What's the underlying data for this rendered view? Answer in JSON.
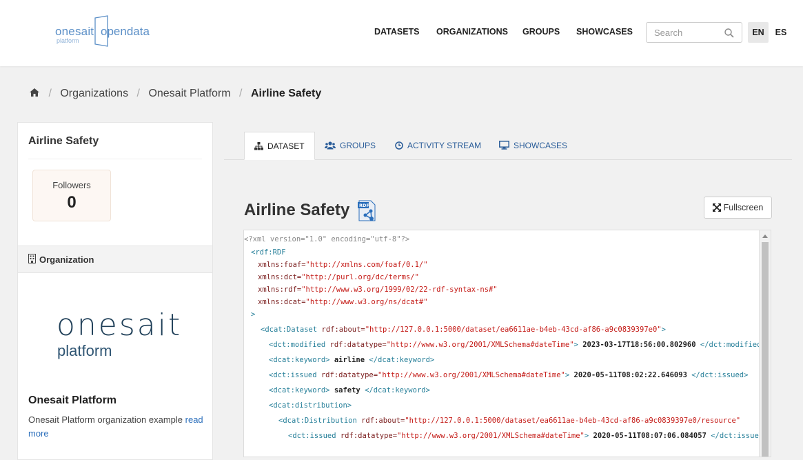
{
  "header": {
    "logo": {
      "left": "onesait",
      "sub": "platform",
      "right": "opendata"
    },
    "nav": [
      "DATASETS",
      "ORGANIZATIONS",
      "GROUPS",
      "SHOWCASES"
    ],
    "search_placeholder": "Search",
    "languages": [
      "EN",
      "ES"
    ],
    "active_language": "EN"
  },
  "breadcrumb": [
    "Organizations",
    "Onesait Platform",
    "Airline Safety"
  ],
  "sidebar": {
    "title": "Airline Safety",
    "followers_label": "Followers",
    "followers_count": "0",
    "org_section_label": "Organization",
    "org_logo_line1": "onesait",
    "org_logo_line2": "platform",
    "org_name": "Onesait Platform",
    "org_description": "Onesait Platform organization example",
    "read_more": "read more"
  },
  "tabs": [
    "DATASET",
    "GROUPS",
    "ACTIVITY STREAM",
    "SHOWCASES"
  ],
  "main": {
    "dataset_title": "Airline Safety",
    "fullscreen_label": "Fullscreen"
  },
  "code": [
    [
      [
        "p",
        "<?xml version=\"1.0\" encoding=\"utf-8\"?>"
      ]
    ],
    [
      [
        "t",
        "<rdf:RDF"
      ]
    ],
    [
      [
        "a",
        "xmlns:foaf="
      ],
      [
        "s",
        "\"http://xmlns.com/foaf/0.1/\""
      ]
    ],
    [
      [
        "a",
        "xmlns:dct="
      ],
      [
        "s",
        "\"http://purl.org/dc/terms/\""
      ]
    ],
    [
      [
        "a",
        "xmlns:rdf="
      ],
      [
        "s",
        "\"http://www.w3.org/1999/02/22-rdf-syntax-ns#\""
      ]
    ],
    [
      [
        "a",
        "xmlns:dcat="
      ],
      [
        "s",
        "\"http://www.w3.org/ns/dcat#\""
      ]
    ],
    [
      [
        "t",
        ">"
      ]
    ],
    [
      [
        "t",
        "<dcat:Dataset "
      ],
      [
        "a",
        "rdf:about="
      ],
      [
        "s",
        "\"http://127.0.0.1:5000/dataset/ea6611ae-b4eb-43cd-af86-a9c0839397e0\""
      ],
      [
        "t",
        ">"
      ]
    ],
    [
      [
        "t",
        "<dct:modified "
      ],
      [
        "a",
        "rdf:datatype="
      ],
      [
        "s",
        "\"http://www.w3.org/2001/XMLSchema#dateTime\""
      ],
      [
        "t",
        "> "
      ],
      [
        "v",
        "2023-03-17T18:56:00.802960"
      ],
      [
        "t",
        " </dct:modified>"
      ]
    ],
    [
      [
        "t",
        "<dcat:keyword> "
      ],
      [
        "v",
        "airline"
      ],
      [
        "t",
        " </dcat:keyword>"
      ]
    ],
    [
      [
        "t",
        "<dct:issued "
      ],
      [
        "a",
        "rdf:datatype="
      ],
      [
        "s",
        "\"http://www.w3.org/2001/XMLSchema#dateTime\""
      ],
      [
        "t",
        "> "
      ],
      [
        "v",
        "2020-05-11T08:02:22.646093"
      ],
      [
        "t",
        " </dct:issued>"
      ]
    ],
    [
      [
        "t",
        "<dcat:keyword> "
      ],
      [
        "v",
        "safety"
      ],
      [
        "t",
        " </dcat:keyword>"
      ]
    ],
    [
      [
        "t",
        "<dcat:distribution>"
      ]
    ],
    [
      [
        "t",
        "<dcat:Distribution "
      ],
      [
        "a",
        "rdf:about="
      ],
      [
        "s",
        "\"http://127.0.0.1:5000/dataset/ea6611ae-b4eb-43cd-af86-a9c0839397e0/resource\""
      ]
    ],
    [
      [
        "t",
        "<dct:issued "
      ],
      [
        "a",
        "rdf:datatype="
      ],
      [
        "s",
        "\"http://www.w3.org/2001/XMLSchema#dateTime\""
      ],
      [
        "t",
        "> "
      ],
      [
        "v",
        "2020-05-11T08:07:06.084057"
      ],
      [
        "t",
        " </dct:issued>"
      ]
    ]
  ]
}
